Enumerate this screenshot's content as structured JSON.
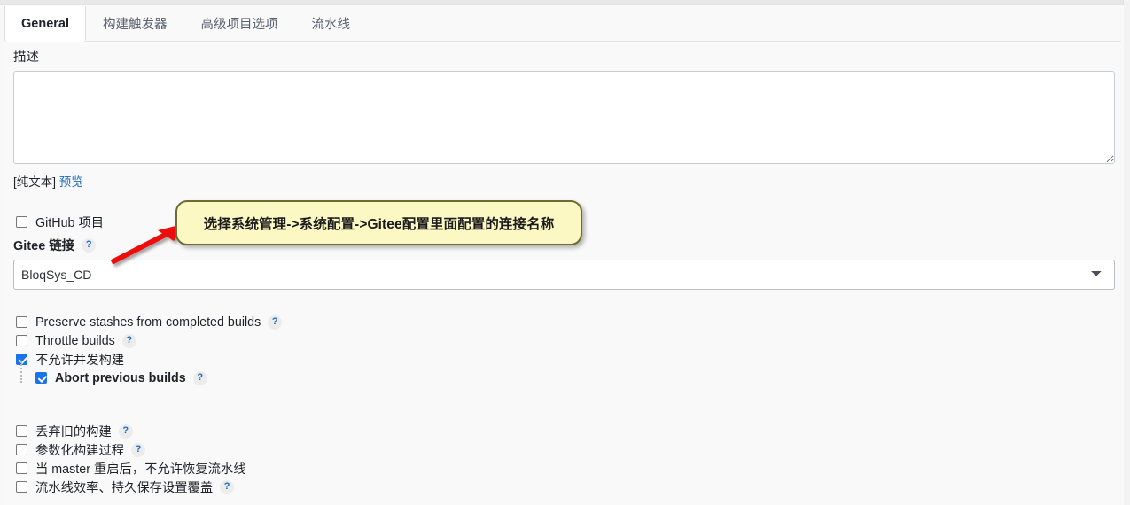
{
  "tabs": [
    {
      "label": "General",
      "active": true
    },
    {
      "label": "构建触发器",
      "active": false
    },
    {
      "label": "高级项目选项",
      "active": false
    },
    {
      "label": "流水线",
      "active": false
    }
  ],
  "description": {
    "label": "描述",
    "value": "",
    "placeholder": "",
    "plain_text_note": "[纯文本]",
    "preview_link": "预览"
  },
  "github_project": {
    "label": "GitHub 项目",
    "checked": false
  },
  "gitee": {
    "label": "Gitee 链接",
    "help": "?",
    "selected": "BloqSys_CD",
    "options": [
      "BloqSys_CD"
    ]
  },
  "options_group_1": [
    {
      "label": "Preserve stashes from completed builds",
      "checked": false,
      "help": "?",
      "bold": false,
      "indent": false
    },
    {
      "label": "Throttle builds",
      "checked": false,
      "help": "?",
      "bold": false,
      "indent": false
    },
    {
      "label": "不允许并发构建",
      "checked": true,
      "help": "",
      "bold": false,
      "indent": false
    },
    {
      "label": "Abort previous builds",
      "checked": true,
      "help": "?",
      "bold": true,
      "indent": true
    }
  ],
  "options_group_2": [
    {
      "label": "丢弃旧的构建",
      "checked": false,
      "help": "?"
    },
    {
      "label": "参数化构建过程",
      "checked": false,
      "help": "?"
    },
    {
      "label": "当 master 重启后，不允许恢复流水线",
      "checked": false,
      "help": ""
    },
    {
      "label": "流水线效率、持久保存设置覆盖",
      "checked": false,
      "help": "?"
    }
  ],
  "annotation": {
    "callout_text": "选择系统管理->系统配置->Gitee配置里面配置的连接名称",
    "callout_fill": "#fbf8c4",
    "callout_border": "#6d6a32",
    "arrow_color": "#ee1111"
  }
}
